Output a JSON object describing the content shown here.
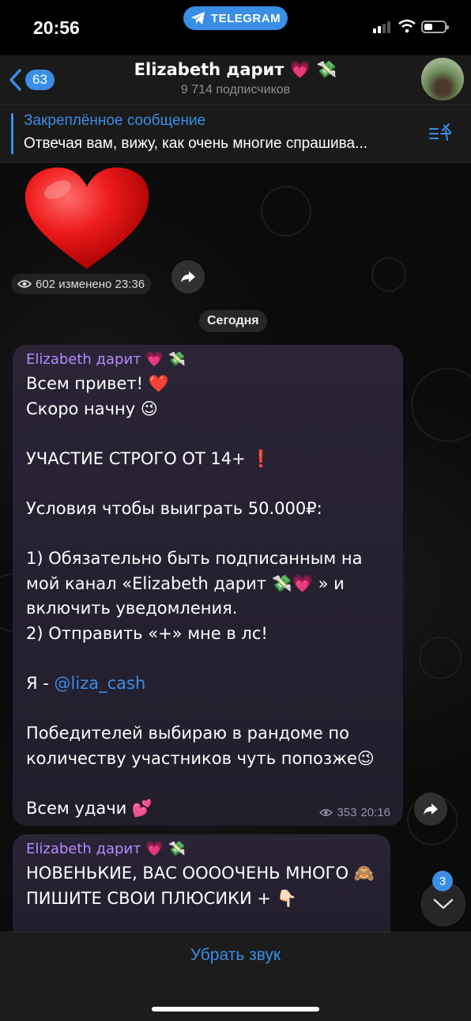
{
  "status_bar": {
    "time": "20:56",
    "app_pill": "TELEGRAM"
  },
  "header": {
    "back_count": "63",
    "title": "Elizabeth дарит 💗 💸",
    "subtitle": "9 714 подписчиков"
  },
  "pinned": {
    "title": "Закреплённое сообщение",
    "text": "Отвечая вам, вижу, как очень многие спрашива..."
  },
  "sticker_message": {
    "views_and_time": "602 изменено 23:36"
  },
  "date_divider": "Сегодня",
  "message1": {
    "sender": "Elizabeth дарит 💗 💸",
    "text_before_link": "Всем привет! ❤️\nСкоро начну 😉\n\nУЧАСТИЕ СТРОГО ОТ 14+ ❗\n\nУсловия чтобы выиграть 50.000₽:\n\n1) Обязательно быть подписанным на мой канал «Elizabeth дарит 💸💗 » и включить уведомления.\n2) Отправить «+» мне в лс!\n\nЯ - ",
    "link": "@liza_cash",
    "text_after_link": "\n\nПобедителей выбираю в рандоме по количеству участников чуть попозже😉\n\nВсем удачи 💕",
    "views": "353",
    "time": "20:16"
  },
  "message2": {
    "sender": "Elizabeth дарит 💗 💸",
    "text": "НОВЕНЬКИЕ, ВАС ООООЧЕНЬ МНОГО 🙈\nПИШИТЕ СВОИ ПЛЮСИКИ + 👇🏻"
  },
  "scroll_down_badge": "3",
  "bottom": {
    "mute_label": "Убрать звук"
  },
  "colors": {
    "accent": "#3a8ee6",
    "sender": "#b58bff",
    "bubble": "#2a2436"
  },
  "icons": [
    "telegram-icon",
    "signal-icon",
    "wifi-icon",
    "battery-icon",
    "back-chevron-icon",
    "pin-list-icon",
    "eye-icon",
    "forward-icon",
    "chevron-down-icon"
  ]
}
